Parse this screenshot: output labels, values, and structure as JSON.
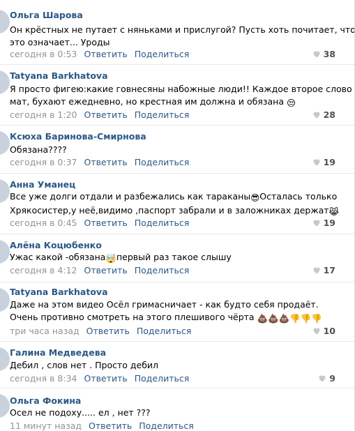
{
  "comments": [
    {
      "author": "Ольга Шарова",
      "lines": [
        "Он крёстных не путает с няньками и прислугой? Пусть хоть почитает, что",
        "это означает... Уроды"
      ],
      "time": "сегодня в 0:53",
      "reply": "Ответить",
      "share": "Поделиться",
      "likes": "38"
    },
    {
      "author": "Tatyana Barkhatova",
      "lines": [
        "Я просто фигею:какие говнесяны набожные люди!! Каждое второе слово -",
        "мат, бухают ежедневно, но крестная им должна и обязана"
      ],
      "emoji_line2": "😒",
      "time": "сегодня в 1:20",
      "reply": "Ответить",
      "share": "Поделиться",
      "likes": "28"
    },
    {
      "author": "Ксюха Баринова-Смирнова",
      "lines": [
        "Обязана????"
      ],
      "time": "сегодня в 0:37",
      "reply": "Ответить",
      "share": "Поделиться",
      "likes": "19"
    },
    {
      "author": "Анна Уманец",
      "lines": [
        "Все уже долги отдали и разбежались как тараканы",
        "Хрякосистер,у неё,видимо ,паспорт забрали и в заложниках держат"
      ],
      "emoji_line1": "😎",
      "line1_tail": "Осталась только",
      "emoji_line2": "😹",
      "time": "сегодня в 0:45",
      "reply": "Ответить",
      "share": "Поделиться",
      "likes": "19"
    },
    {
      "author": "Алёна Коцюбенко",
      "lines": [
        "Ужас какой -обязана",
        "первый раз такое слышу"
      ],
      "emoji_line1": "🤯",
      "time": "сегодня в 4:12",
      "reply": "Ответить",
      "share": "Поделиться",
      "likes": "17"
    },
    {
      "author": "Tatyana Barkhatova",
      "lines": [
        "Даже на этом видео Осёл гримасничает - как будто себя продаёт.",
        "Очень противно смотреть на этого плешивого чёрта"
      ],
      "emoji_line2": "💩💩💩👎👎👎",
      "time": "три часа назад",
      "reply": "Ответить",
      "share": "Поделиться",
      "likes": "10"
    },
    {
      "author": "Галина Медведева",
      "lines": [
        "Дебил , слов нет . Просто дебил"
      ],
      "time": "сегодня в 8:34",
      "reply": "Ответить",
      "share": "Поделиться",
      "likes": "9"
    },
    {
      "author": "Ольга Фокина",
      "lines": [
        "Осел не подоху..... ел , нет ???"
      ],
      "time": "11 минут назад",
      "reply": "Ответить",
      "share": "Поделиться",
      "likes": ""
    }
  ],
  "icons": {
    "like": "heart-icon"
  },
  "colors": {
    "link": "#2a5885",
    "meta": "#939393",
    "divider": "#e7e8ec"
  }
}
